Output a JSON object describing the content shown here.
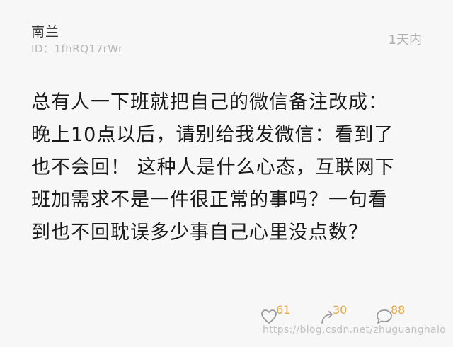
{
  "author": {
    "name": "南兰",
    "id": "ID：1fhRQ17rWr"
  },
  "post": {
    "time": "1天内",
    "lines": [
      "总有人一下班就把自己的微信备注改成：",
      "晚上10点以后，请别给我发微信：看到了",
      "也不会回！ 这种人是什么心态，互联网下",
      "班加需求不是一件很正常的事吗？一句看",
      "到也不回耽误多少事自己心里没点数？"
    ]
  },
  "actions": {
    "likes": "61",
    "shares": "30",
    "comments": "88",
    "icons": {
      "like": "heart-icon",
      "share": "share-arrow-icon",
      "comment": "comment-bubble-icon"
    },
    "count_color": "#e8a94a"
  },
  "watermark": "https://blog.csdn.net/zhuguanghalo"
}
